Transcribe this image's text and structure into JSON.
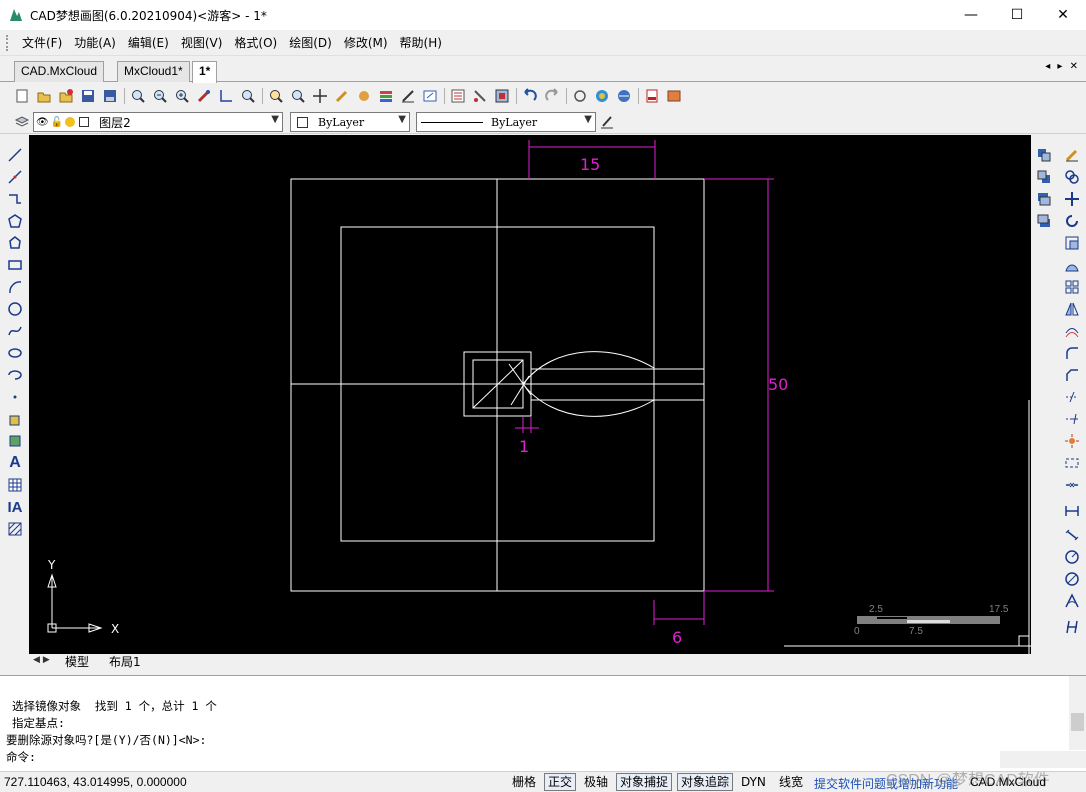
{
  "window": {
    "title": "CAD梦想画图(6.0.20210904)<游客> - 1*",
    "minimize": "—",
    "maximize": "☐",
    "close": "✕"
  },
  "menu": [
    "文件(F)",
    "功能(A)",
    "编辑(E)",
    "视图(V)",
    "格式(O)",
    "绘图(D)",
    "修改(M)",
    "帮助(H)"
  ],
  "tabs": [
    "CAD.MxCloud",
    "MxCloud1*",
    "1*"
  ],
  "active_tab": "1*",
  "tab_nav": "◂ ▸ ✕",
  "layer_bar": {
    "layer": "图层2",
    "color": "ByLayer",
    "linetype": "ByLayer"
  },
  "layout_tabs": [
    "模型",
    "布局1"
  ],
  "drawing": {
    "dimensions": [
      "15",
      "50",
      "1",
      "6"
    ],
    "scale_labels": [
      "2.5",
      "17.5",
      "0",
      "7.5"
    ],
    "axis_x": "X",
    "axis_y": "Y",
    "dim_color": "#e020d0",
    "line_color": "#ffffff"
  },
  "command": {
    "lines": [
      "选择镜像对象  找到 1 个，总计 1 个",
      "指定基点:",
      "要删除源对象吗?[是(Y)/否(N)]<N>:"
    ],
    "prompt": "命令:"
  },
  "status": {
    "coords": "727.110463,  43.014995,  0.000000",
    "buttons": [
      {
        "label": "栅格",
        "on": false
      },
      {
        "label": "正交",
        "on": true
      },
      {
        "label": "极轴",
        "on": false
      },
      {
        "label": "对象捕捉",
        "on": true
      },
      {
        "label": "对象追踪",
        "on": true
      },
      {
        "label": "DYN",
        "on": false
      },
      {
        "label": "线宽",
        "on": false
      }
    ],
    "feedback": "提交软件问题或增加新功能",
    "brand": "CAD.MxCloud",
    "watermark": "CSDN @梦想CAD软件"
  }
}
